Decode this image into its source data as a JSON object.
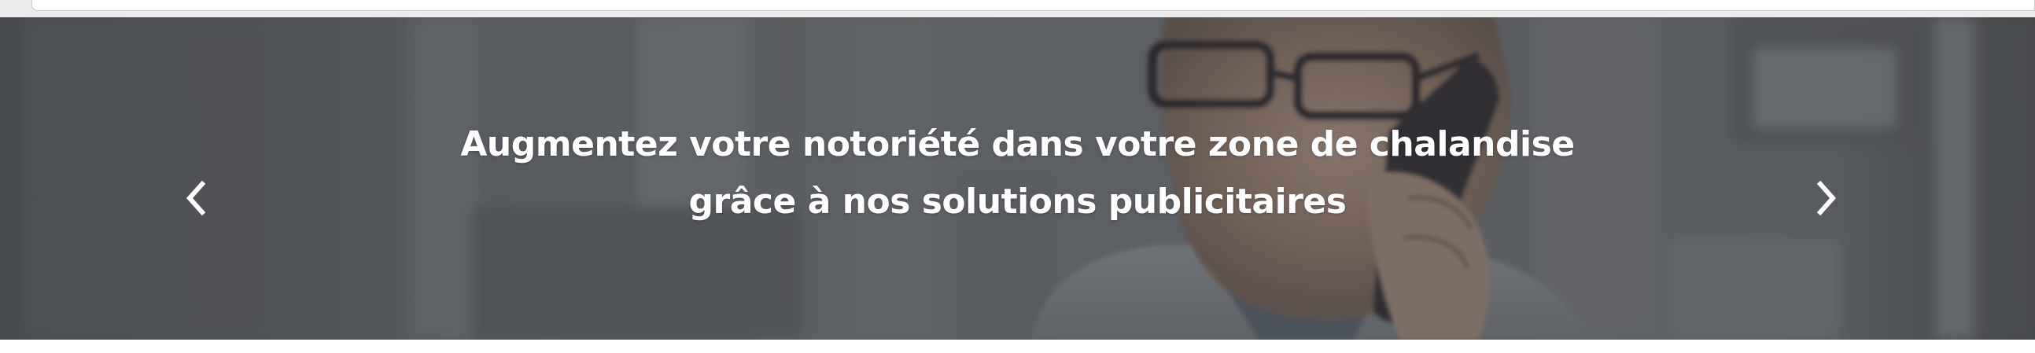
{
  "browser": {
    "address_bar": ""
  },
  "hero": {
    "caption_line1": "Augmentez votre notoriété dans votre zone de chalandise",
    "caption_line2": "grâce à nos solutions publicitaires",
    "prev_icon": "chevron-left-icon",
    "next_icon": "chevron-right-icon",
    "text_color": "#ffffff"
  }
}
